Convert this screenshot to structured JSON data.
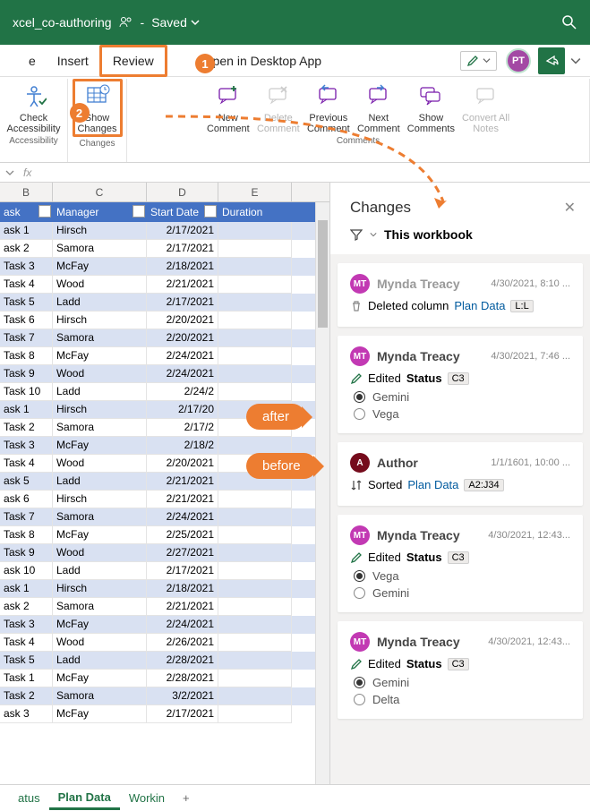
{
  "titlebar": {
    "filename": "xcel_co-authoring",
    "saved_text": "Saved"
  },
  "tabs": {
    "t0": "e",
    "insert": "Insert",
    "review": "Review",
    "open_desktop": "Open in Desktop App",
    "avatar_initials": "PT"
  },
  "badges": {
    "one": "1",
    "two": "2"
  },
  "ribbon": {
    "check_accessibility_l1": "Check",
    "check_accessibility_l2": "Accessibility",
    "show_changes_l1": "Show",
    "show_changes_l2": "Changes",
    "new_comment_l1": "New",
    "new_comment_l2": "Comment",
    "delete_comment_l1": "Delete",
    "delete_comment_l2": "Comment",
    "previous_comment_l1": "Previous",
    "previous_comment_l2": "Comment",
    "next_comment_l1": "Next",
    "next_comment_l2": "Comment",
    "show_comments_l1": "Show",
    "show_comments_l2": "Comments",
    "convert_notes_l1": "Convert All",
    "convert_notes_l2": "Notes",
    "group_accessibility": "Accessibility",
    "group_changes": "Changes",
    "group_comments": "Comments"
  },
  "fxbar": {
    "fx": "fx"
  },
  "columns": {
    "B": "B",
    "C": "C",
    "D": "D",
    "E": "E"
  },
  "headers": {
    "task": "ask",
    "manager": "Manager",
    "start": "Start Date",
    "duration": "Duration"
  },
  "rows": [
    {
      "t": "ask 1",
      "m": "Hirsch",
      "d": "2/17/2021"
    },
    {
      "t": "ask 2",
      "m": "Samora",
      "d": "2/17/2021"
    },
    {
      "t": "Task 3",
      "m": "McFay",
      "d": "2/18/2021"
    },
    {
      "t": "Task 4",
      "m": "Wood",
      "d": "2/21/2021"
    },
    {
      "t": "Task 5",
      "m": "Ladd",
      "d": "2/17/2021"
    },
    {
      "t": "Task 6",
      "m": "Hirsch",
      "d": "2/20/2021"
    },
    {
      "t": "Task 7",
      "m": "Samora",
      "d": "2/20/2021"
    },
    {
      "t": "Task 8",
      "m": "McFay",
      "d": "2/24/2021"
    },
    {
      "t": "Task 9",
      "m": "Wood",
      "d": "2/24/2021"
    },
    {
      "t": "Task 10",
      "m": "Ladd",
      "d": "2/24/2"
    },
    {
      "t": "ask 1",
      "m": "Hirsch",
      "d": "2/17/20"
    },
    {
      "t": "Task 2",
      "m": "Samora",
      "d": "2/17/2"
    },
    {
      "t": "Task 3",
      "m": "McFay",
      "d": "2/18/2"
    },
    {
      "t": "Task 4",
      "m": "Wood",
      "d": "2/20/2021"
    },
    {
      "t": "ask 5",
      "m": "Ladd",
      "d": "2/21/2021"
    },
    {
      "t": "ask 6",
      "m": "Hirsch",
      "d": "2/21/2021"
    },
    {
      "t": "Task 7",
      "m": "Samora",
      "d": "2/24/2021"
    },
    {
      "t": "Task 8",
      "m": "McFay",
      "d": "2/25/2021"
    },
    {
      "t": "Task 9",
      "m": "Wood",
      "d": "2/27/2021"
    },
    {
      "t": "ask 10",
      "m": "Ladd",
      "d": "2/17/2021"
    },
    {
      "t": "ask 1",
      "m": "Hirsch",
      "d": "2/18/2021"
    },
    {
      "t": "ask 2",
      "m": "Samora",
      "d": "2/21/2021"
    },
    {
      "t": "Task 3",
      "m": "McFay",
      "d": "2/24/2021"
    },
    {
      "t": "Task 4",
      "m": "Wood",
      "d": "2/26/2021"
    },
    {
      "t": "Task 5",
      "m": "Ladd",
      "d": "2/28/2021"
    },
    {
      "t": "Task 1",
      "m": "McFay",
      "d": "2/28/2021"
    },
    {
      "t": "Task 2",
      "m": "Samora",
      "d": "3/2/2021"
    },
    {
      "t": "ask 3",
      "m": "McFay",
      "d": "2/17/2021"
    }
  ],
  "pane": {
    "title": "Changes",
    "filter_label": "This workbook",
    "cards": [
      {
        "initials": "MT",
        "avatar": "purple",
        "user": "Mynda Treacy",
        "grey": true,
        "time": "4/30/2021, 8:10 ...",
        "action_verb": "Deleted column",
        "link": "Plan Data",
        "ref": "L:L",
        "icon": "delete"
      },
      {
        "initials": "MT",
        "avatar": "purple",
        "user": "Mynda Treacy",
        "time": "4/30/2021, 7:46 ...",
        "action_verb": "Edited",
        "bold": "Status",
        "ref": "C3",
        "icon": "edit",
        "opts": [
          {
            "t": "Gemini",
            "sel": true
          },
          {
            "t": "Vega",
            "sel": false
          }
        ]
      },
      {
        "initials": "A",
        "avatar": "darkpurple",
        "user": "Author",
        "time": "1/1/1601, 10:00 ...",
        "action_verb": "Sorted",
        "link": "Plan Data",
        "ref": "A2:J34",
        "icon": "sort"
      },
      {
        "initials": "MT",
        "avatar": "purple",
        "user": "Mynda Treacy",
        "time": "4/30/2021, 12:43...",
        "action_verb": "Edited",
        "bold": "Status",
        "ref": "C3",
        "icon": "edit",
        "opts": [
          {
            "t": "Vega",
            "sel": true
          },
          {
            "t": "Gemini",
            "sel": false
          }
        ]
      },
      {
        "initials": "MT",
        "avatar": "purple",
        "user": "Mynda Treacy",
        "time": "4/30/2021, 12:43...",
        "action_verb": "Edited",
        "bold": "Status",
        "ref": "C3",
        "icon": "edit",
        "opts": [
          {
            "t": "Gemini",
            "sel": true
          },
          {
            "t": "Delta",
            "sel": false
          }
        ]
      }
    ]
  },
  "sheettabs": {
    "status": "atus",
    "plan": "Plan Data",
    "working": "Workin"
  },
  "speech": {
    "after": "after",
    "before": "before"
  }
}
